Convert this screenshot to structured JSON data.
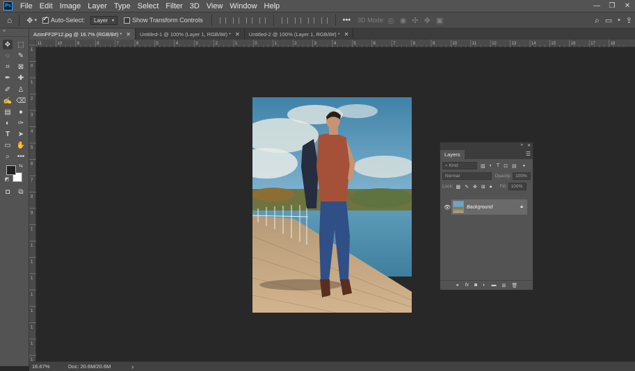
{
  "menubar": {
    "logo": "Ps",
    "items": [
      "File",
      "Edit",
      "Image",
      "Layer",
      "Type",
      "Select",
      "Filter",
      "3D",
      "View",
      "Window",
      "Help"
    ],
    "window_controls": [
      "—",
      "❐",
      "✕"
    ]
  },
  "options_bar": {
    "auto_select_label": "Auto-Select:",
    "auto_select_checked": true,
    "auto_select_target": "Layer",
    "show_transform_label": "Show Transform Controls",
    "show_transform_checked": false,
    "more_label": "•••",
    "mode_3d_label": "3D Mode:"
  },
  "tabs": [
    {
      "label": "AzimFF2P12.jpg @ 16.7% (RGB/8#) *",
      "active": true
    },
    {
      "label": "Untitled-1 @ 100% (Layer 1, RGB/8#) *",
      "active": false
    },
    {
      "label": "Untitled-2 @ 100% (Layer 1, RGB/8#) *",
      "active": false
    }
  ],
  "ruler_top_labels": [
    "11",
    "10",
    "9",
    "8",
    "7",
    "6",
    "5",
    "4",
    "3",
    "2",
    "1",
    "0",
    "1",
    "2",
    "3",
    "4",
    "5",
    "6",
    "7",
    "8",
    "9",
    "10",
    "11",
    "12",
    "13",
    "14",
    "15",
    "16",
    "17",
    "18"
  ],
  "ruler_left_labels": [
    "1",
    "0",
    "1",
    "2",
    "3",
    "4",
    "5",
    "6",
    "7",
    "8",
    "9",
    "1",
    "1",
    "1",
    "1",
    "1",
    "1",
    "1",
    "1",
    "1"
  ],
  "status": {
    "zoom": "16.67%",
    "doc": "Doc: 20.6M/20.6M",
    "arrow": "›"
  },
  "layers_panel": {
    "title": "Layers",
    "kind_placeholder": "Kind",
    "blend_mode": "Normal",
    "opacity_label": "Opacity:",
    "opacity_value": "100%",
    "lock_label": "Lock:",
    "fill_label": "Fill:",
    "fill_value": "100%",
    "layers": [
      {
        "name": "Background",
        "locked": true,
        "visible": true
      }
    ]
  }
}
